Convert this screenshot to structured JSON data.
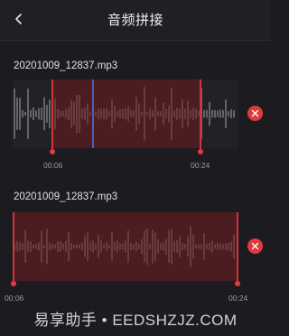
{
  "header": {
    "title": "音频拼接",
    "back_icon": "chevron-left-icon"
  },
  "clips": [
    {
      "file_name": "20201009_12837.mp3",
      "selection_start": "00:06",
      "selection_end": "00:24",
      "delete_icon": "close-icon"
    },
    {
      "file_name": "20201009_12837.mp3",
      "selection_start": "00:06",
      "selection_end": "00:24",
      "delete_icon": "close-icon"
    }
  ],
  "colors": {
    "background": "#1c1c20",
    "selection": "#6e181c",
    "handle": "#d3333a",
    "cursor": "#4b5fbf",
    "delete": "#e03a3e"
  },
  "watermark": "易享助手 • EEDSHZJZ.COM"
}
